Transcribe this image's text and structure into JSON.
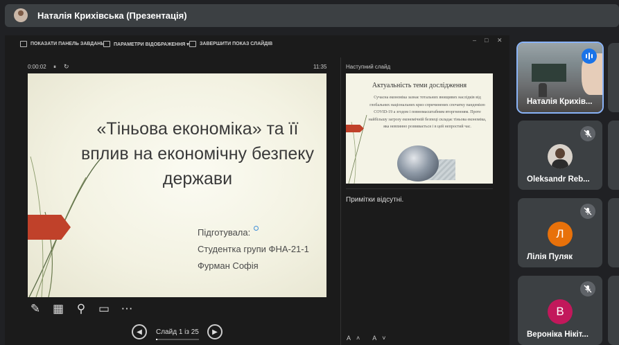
{
  "top": {
    "title": "Наталія Крихівська (Презентація)"
  },
  "toolbar": {
    "taskbar": "ПОКАЗАТИ ПАНЕЛЬ ЗАВДАНЬ",
    "display": "ПАРАМЕТРИ ВІДОБРАЖЕННЯ ▾",
    "end": "ЗАВЕРШИТИ ПОКАЗ СЛАЙДІВ",
    "win_min": "–",
    "win_max": "□",
    "win_close": "✕"
  },
  "presenter": {
    "timer": "0:00:02",
    "pause": "⏸",
    "restart": "↻",
    "clock": "11:35",
    "next_label": "Наступний слайд",
    "notes": "Примітки відсутні.",
    "font_buttons": "A˄ A˅",
    "slide_counter": "Слайд 1 із 25",
    "progress": 0.04,
    "prev": "◀",
    "next": "▶"
  },
  "slide": {
    "title": "«Тіньова економіка» та її вплив на економічну безпеку держави",
    "sub1": "Підготувала:",
    "sub2": "Студентка групи ФНА-21-1",
    "sub3": "Фурман Софія"
  },
  "next_slide": {
    "title": "Актуальність теми дослідження",
    "body": "Сучасна економіка зазнає тотальних внищивих наслідків від глобальних національних криз спричинених спочатку пандемією COVID-19 а згодом і повномасштабним вторгненням. Проте найбільшу загрозу економічній безпеці складає тіньова економіка, яка невпинно розвивається і в цей непростий час."
  },
  "tools": [
    "pen-icon",
    "slides-grid-icon",
    "zoom-icon",
    "screen-icon",
    "more-icon"
  ],
  "participants": [
    {
      "name": "Наталія Крихів...",
      "type": "video",
      "speaking": true
    },
    {
      "name": "Oleksandr Reb...",
      "type": "photo",
      "muted": true
    },
    {
      "name": "Лілія Пуляк",
      "initial": "Л",
      "color": "#e8710a",
      "muted": true
    },
    {
      "name": "Вероніка Нікіт...",
      "initial": "В",
      "color": "#c2185b",
      "muted": true
    }
  ],
  "icons": {
    "mic_off": "🎙̸"
  }
}
